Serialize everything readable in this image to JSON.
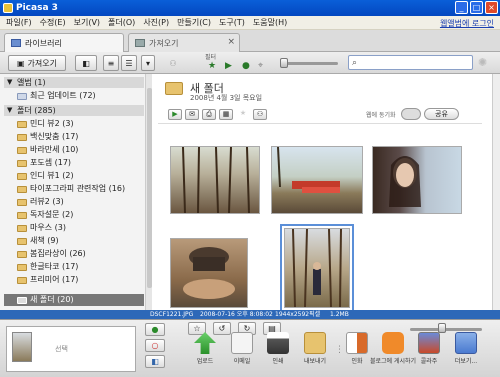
{
  "window": {
    "title": "Picasa 3"
  },
  "menu": {
    "items": [
      "파일(F)",
      "수정(E)",
      "보기(V)",
      "폴더(O)",
      "사진(P)",
      "만들기(C)",
      "도구(T)",
      "도움말(H)"
    ],
    "sync_link": "웹앨범에 로그인"
  },
  "tabs": [
    {
      "label": "라이브러리"
    },
    {
      "label": "가져오기"
    }
  ],
  "toolbar": {
    "import_label": "가져오기",
    "filter_label": "필터",
    "search_placeholder": ""
  },
  "sidebar": {
    "groups": [
      {
        "label": "앨범 (1)"
      },
      {
        "label": "폴더 (285)"
      }
    ],
    "album_items": [
      {
        "label": "최근 업데이트 (72)"
      }
    ],
    "folders": [
      {
        "label": "민디 뷰2 (3)"
      },
      {
        "label": "백신맞춤 (17)"
      },
      {
        "label": "바라만세 (10)"
      },
      {
        "label": "포도셈 (17)"
      },
      {
        "label": "인디 뷰1 (2)"
      },
      {
        "label": "타이포그라피 관련작업 (16)"
      },
      {
        "label": "러뷰2 (3)"
      },
      {
        "label": "독자설문 (2)"
      },
      {
        "label": "마우스 (3)"
      },
      {
        "label": "새책 (9)"
      },
      {
        "label": "봄집라상이 (26)"
      },
      {
        "label": "한글타코 (17)"
      },
      {
        "label": "프리미어 (17)"
      },
      {
        "label": "새 폴더 (20)"
      }
    ]
  },
  "album": {
    "title": "새 폴더",
    "date": "2008년 4월 3일 목요일",
    "share_label": "공유",
    "settings_label": "웹에 동기화"
  },
  "status": {
    "filename": "DSCF1221.JPG",
    "datetime": "2008-07-16 오후 8:08:02",
    "dimensions": "1944x2592픽셀",
    "filesize": "1.2MB"
  },
  "tray": {
    "label": "선택"
  },
  "actions": [
    {
      "label": "업로드"
    },
    {
      "label": "이메일"
    },
    {
      "label": "인쇄"
    },
    {
      "label": "내보내기"
    },
    {
      "label": "인화"
    },
    {
      "label": "블로그에 게시하기"
    },
    {
      "label": "콜라주"
    },
    {
      "label": "더보기..."
    }
  ]
}
